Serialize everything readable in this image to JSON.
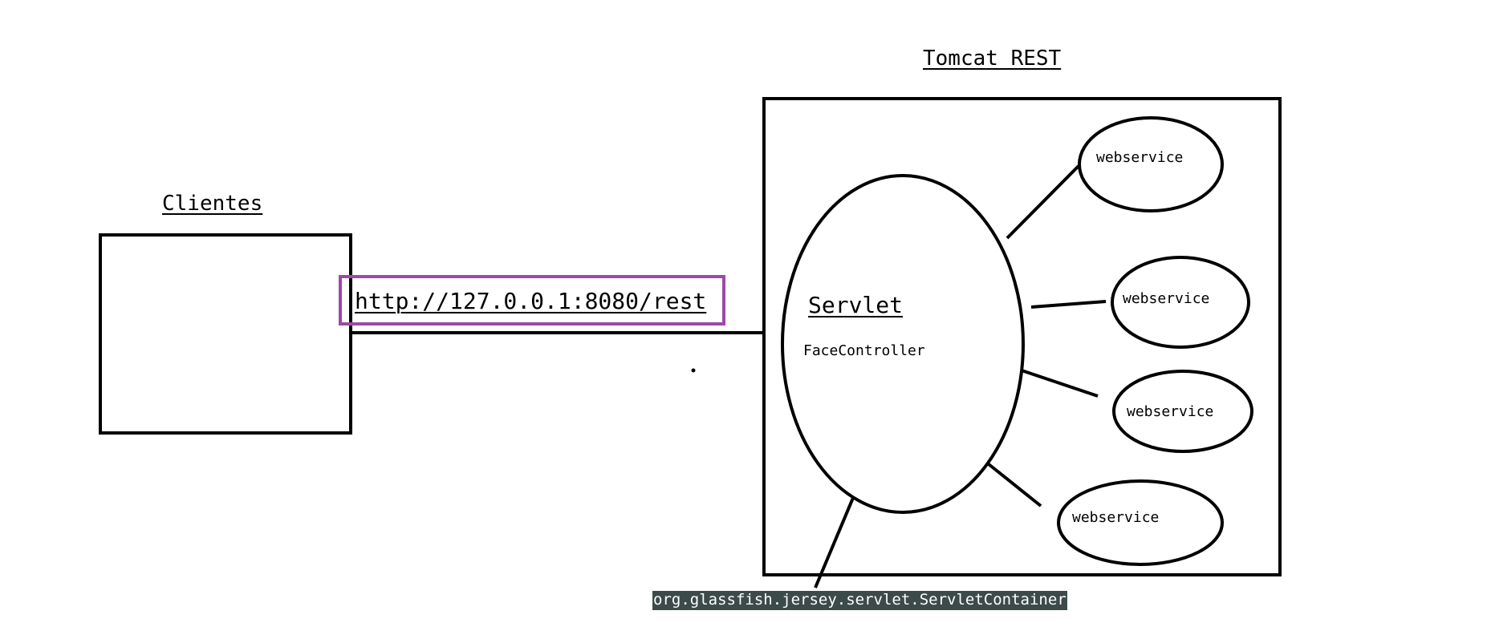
{
  "diagram": {
    "clients_title": "Clientes",
    "server_title": "Tomcat REST",
    "url_label": "http://127.0.0.1:8080/rest",
    "servlet_title": "Servlet",
    "servlet_class": "FaceController",
    "webservices": [
      {
        "label": "webservice"
      },
      {
        "label": "webservice"
      },
      {
        "label": "webservice"
      },
      {
        "label": "webservice"
      }
    ],
    "container_label": "org.glassfish.jersey.servlet.ServletContainer"
  },
  "colors": {
    "stroke": "#000000",
    "url_highlight_border": "#9b4aa6",
    "container_label_bg": "#3d4a4a",
    "container_label_text": "#ffffff"
  }
}
